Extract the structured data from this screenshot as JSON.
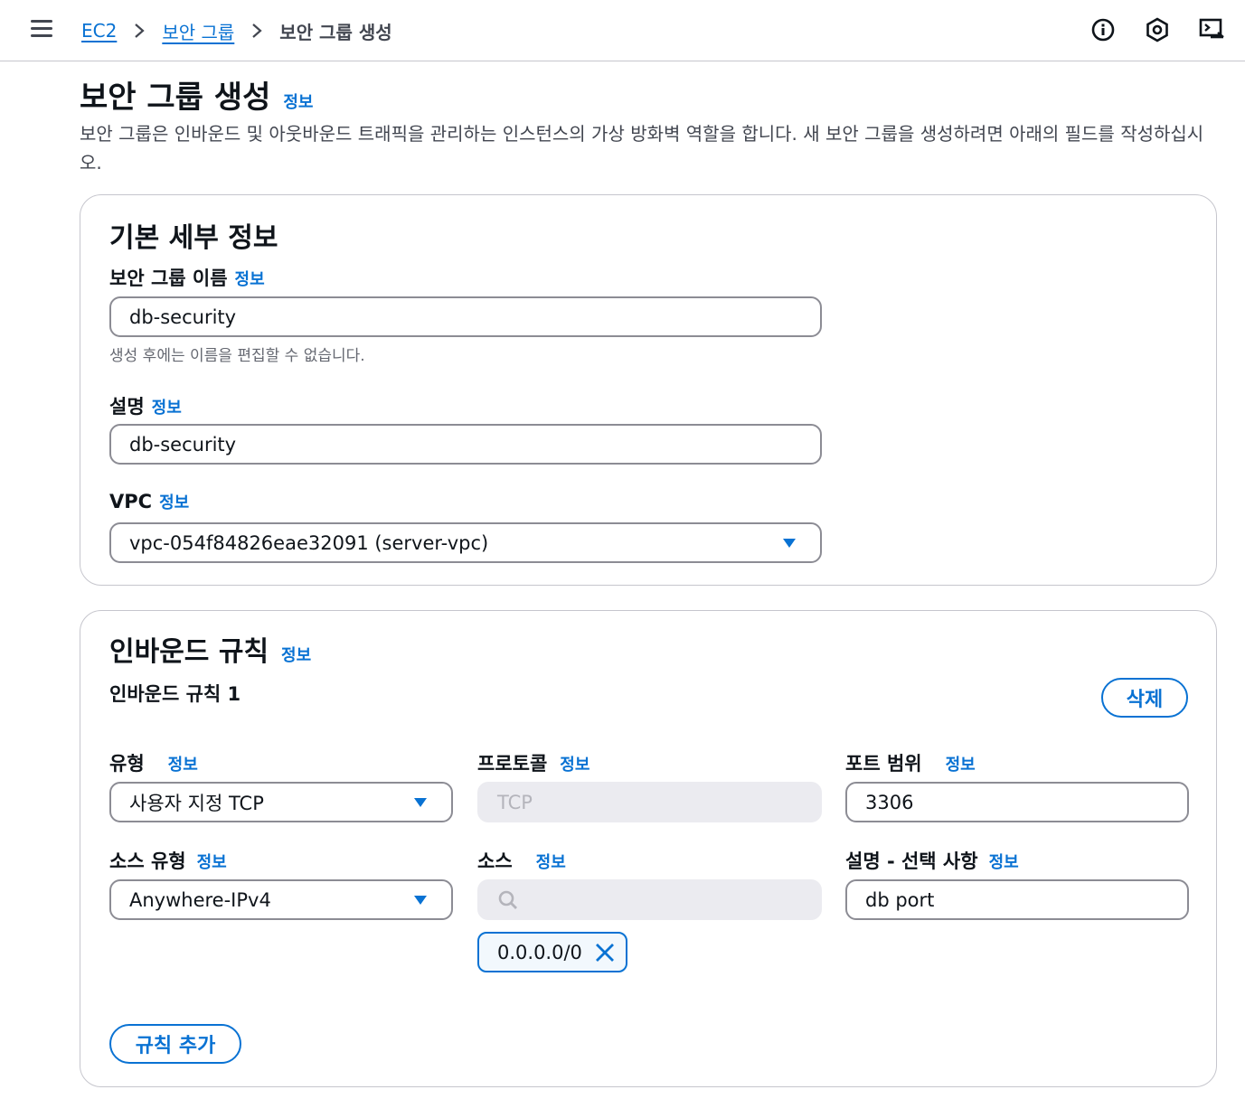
{
  "breadcrumb": {
    "items": [
      "EC2",
      "보안 그룹"
    ],
    "current": "보안 그룹 생성"
  },
  "header": {
    "title": "보안 그룹 생성",
    "info": "정보",
    "description": "보안 그룹은 인바운드 및 아웃바운드 트래픽을 관리하는 인스턴스의 가상 방화벽 역할을 합니다. 새 보안 그룹을 생성하려면 아래의 필드를 작성하십시오."
  },
  "basic": {
    "title": "기본 세부 정보",
    "name_label": "보안 그룹 이름",
    "name_info": "정보",
    "name_value": "db-security",
    "name_hint": "생성 후에는 이름을 편집할 수 없습니다.",
    "desc_label": "설명",
    "desc_info": "정보",
    "desc_value": "db-security",
    "vpc_label": "VPC",
    "vpc_info": "정보",
    "vpc_value": "vpc-054f84826eae32091 (server-vpc)"
  },
  "inbound": {
    "title": "인바운드 규칙",
    "info": "정보",
    "rule_title": "인바운드 규칙 1",
    "delete_label": "삭제",
    "type_label": "유형",
    "type_info": "정보",
    "type_value": "사용자 지정 TCP",
    "protocol_label": "프로토콜",
    "protocol_info": "정보",
    "protocol_value": "TCP",
    "port_label": "포트 범위",
    "port_info": "정보",
    "port_value": "3306",
    "source_type_label": "소스 유형",
    "source_type_info": "정보",
    "source_type_value": "Anywhere-IPv4",
    "source_label": "소스",
    "source_info": "정보",
    "source_token": "0.0.0.0/0",
    "rule_desc_label": "설명 - 선택 사항",
    "rule_desc_info": "정보",
    "rule_desc_value": "db port",
    "add_rule_label": "규칙 추가"
  },
  "icons": [
    "menu-icon",
    "chevron-right-icon",
    "info-circle-icon",
    "settings-hex-icon",
    "cloudshell-icon",
    "caret-down-icon",
    "search-icon",
    "close-icon"
  ],
  "colors": {
    "link": "#0972d3",
    "border": "#8c8c94",
    "disabled_bg": "#ebebf0",
    "text": "#0f141a"
  }
}
